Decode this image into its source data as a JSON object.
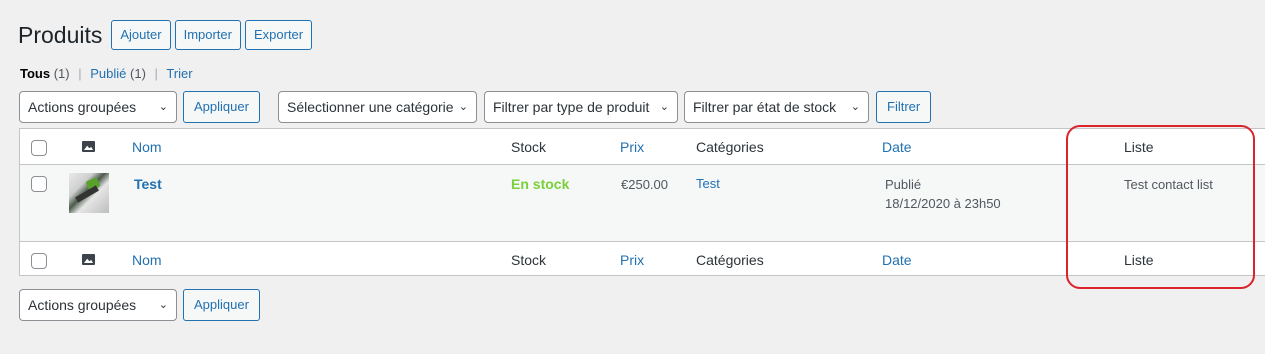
{
  "header": {
    "title": "Produits",
    "actions": [
      "Ajouter",
      "Importer",
      "Exporter"
    ]
  },
  "views": {
    "all_label": "Tous",
    "all_count": "(1)",
    "published_label": "Publié",
    "published_count": "(1)",
    "sort_label": "Trier",
    "separator": "|"
  },
  "filters": {
    "bulk_actions": "Actions groupées",
    "apply": "Appliquer",
    "category": "Sélectionner une catégorie",
    "product_type": "Filtrer par type de produit",
    "stock_status": "Filtrer par état de stock",
    "filter_button": "Filtrer"
  },
  "table": {
    "columns": {
      "name": "Nom",
      "stock": "Stock",
      "price": "Prix",
      "categories": "Catégories",
      "date": "Date",
      "list": "Liste"
    },
    "rows": [
      {
        "name": "Test",
        "stock": "En stock",
        "price": "€250.00",
        "categories": "Test",
        "date_status": "Publié",
        "date_value": "18/12/2020 à 23h50",
        "list": "Test contact list"
      }
    ]
  },
  "bottom": {
    "bulk_actions": "Actions groupées",
    "apply": "Appliquer"
  },
  "colors": {
    "accent": "#2271b1",
    "in_stock": "#7ad03a",
    "highlight": "#d9242b"
  }
}
